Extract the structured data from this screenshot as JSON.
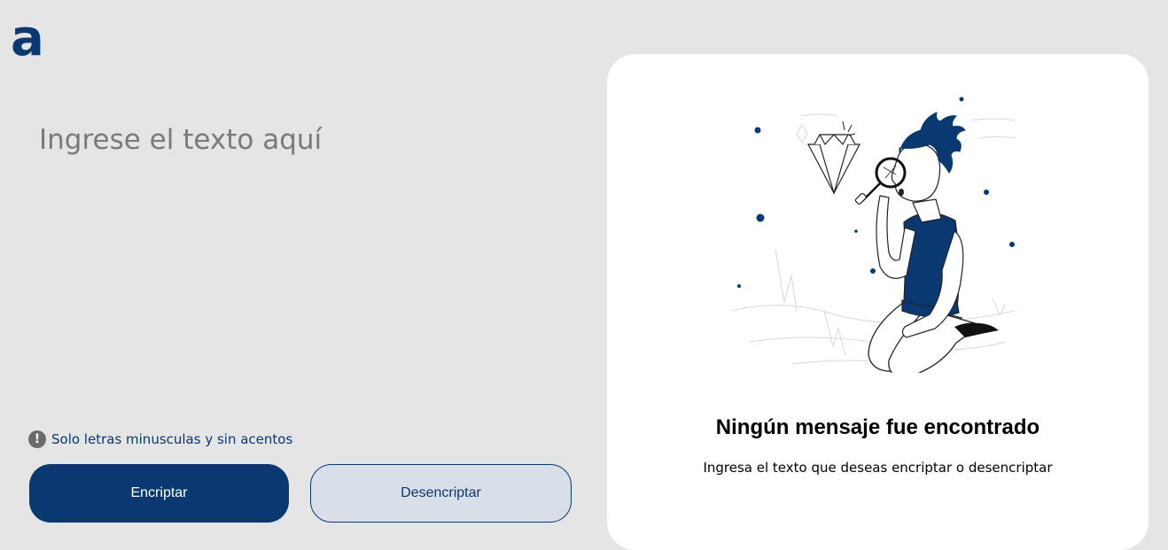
{
  "logo": {
    "text": "a"
  },
  "input": {
    "placeholder": "Ingrese el texto aquí",
    "value": ""
  },
  "hint": {
    "icon": "exclamation-icon",
    "text": "Solo letras minusculas y sin acentos"
  },
  "buttons": {
    "encrypt_label": "Encriptar",
    "decrypt_label": "Desencriptar"
  },
  "output": {
    "title": "Ningún mensaje fue encontrado",
    "subtitle": "Ingresa el texto que deseas encriptar o desencriptar",
    "illustration": "person-with-magnifying-glass"
  },
  "colors": {
    "primary": "#0a3871",
    "background": "#e5e5e5",
    "card": "#ffffff",
    "secondary_button": "#d8dfe8"
  }
}
